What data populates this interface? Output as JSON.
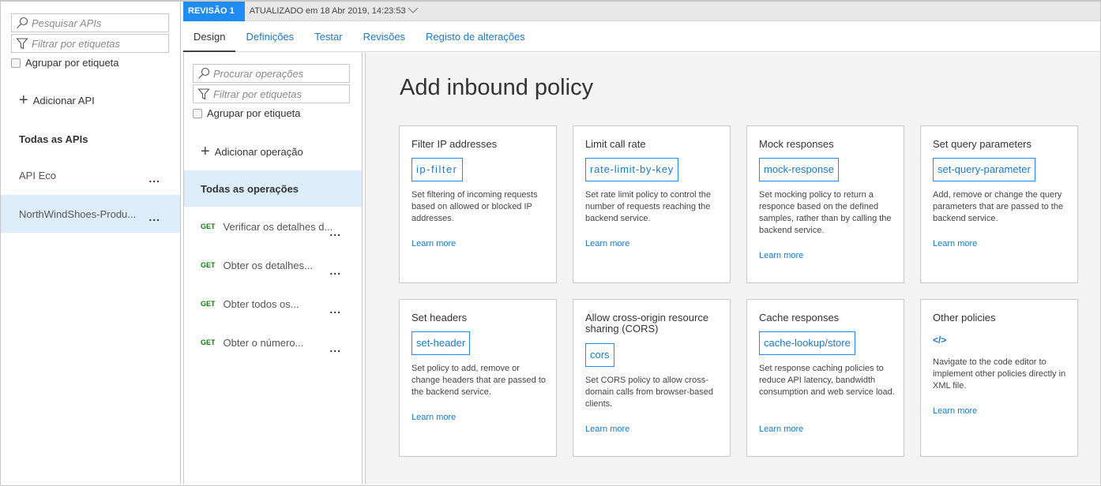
{
  "api_panel": {
    "search_placeholder": "Pesquisar APIs",
    "filter_placeholder": "Filtrar por etiquetas",
    "group_by_tag_label": "Agrupar por etiqueta",
    "add_api_label": "Adicionar API",
    "section_title": "Todas as APIs",
    "apis": [
      {
        "name": "API Eco",
        "selected": false
      },
      {
        "name": "NorthWindShoes-Produ...",
        "selected": true
      }
    ]
  },
  "header": {
    "revision_badge": "REVISÃO 1",
    "updated_text": "ATUALIZADO em 18 Abr 2019, 14:23:53"
  },
  "tabs": [
    {
      "label": "Design",
      "active": true
    },
    {
      "label": "Definições",
      "active": false
    },
    {
      "label": "Testar",
      "active": false
    },
    {
      "label": "Revisões",
      "active": false
    },
    {
      "label": "Registo de alterações",
      "active": false
    }
  ],
  "operations_panel": {
    "search_placeholder": "Procurar operações",
    "filter_placeholder": "Filtrar por etiquetas",
    "group_by_tag_label": "Agrupar por etiqueta",
    "add_operation_label": "Adicionar operação",
    "all_operations_label": "Todas as operações",
    "operations": [
      {
        "verb": "GET",
        "name": "Verificar os detalhes d..."
      },
      {
        "verb": "GET",
        "name": "Obter os detalhes..."
      },
      {
        "verb": "GET",
        "name": "Obter todos os..."
      },
      {
        "verb": "GET",
        "name": "Obter o número..."
      }
    ]
  },
  "main": {
    "title": "Add inbound policy",
    "learn_more_label": "Learn more",
    "cards": [
      {
        "title": "Filter IP addresses",
        "code": "ip-filter",
        "description": "Set filtering of incoming requests based on allowed or blocked IP addresses."
      },
      {
        "title": "Limit call rate",
        "code": "rate-limit-by-key",
        "description": "Set rate limit policy to control the number of requests reaching the backend service."
      },
      {
        "title": "Mock responses",
        "code": "mock-response",
        "description": "Set mocking policy to return a responce based on the defined samples, rather than by calling the backend service."
      },
      {
        "title": "Set query parameters",
        "code": "set-query-parameter",
        "description": "Add, remove or change the query parameters that are passed to the backend service."
      },
      {
        "title": "Set headers",
        "code": "set-header",
        "description": "Set policy to add, remove or change headers that are passed to the backend service."
      },
      {
        "title": "Allow cross-origin resource sharing (CORS)",
        "code": "cors",
        "description": "Set CORS policy to allow cross-domain calls from browser-based clients."
      },
      {
        "title": "Cache responses",
        "code": "cache-lookup/store",
        "description": "Set response caching policies to reduce API latency, bandwidth consumption and web service load."
      },
      {
        "title": "Other policies",
        "icon": "code-icon",
        "icon_glyph": "</>",
        "description": "Navigate to the code editor to implement other policies directly in XML file."
      }
    ]
  },
  "colors": {
    "accent": "#1e8cf0",
    "link": "#1e78c8",
    "selected_bg": "#ddedf9",
    "get_verb": "#107c10"
  }
}
